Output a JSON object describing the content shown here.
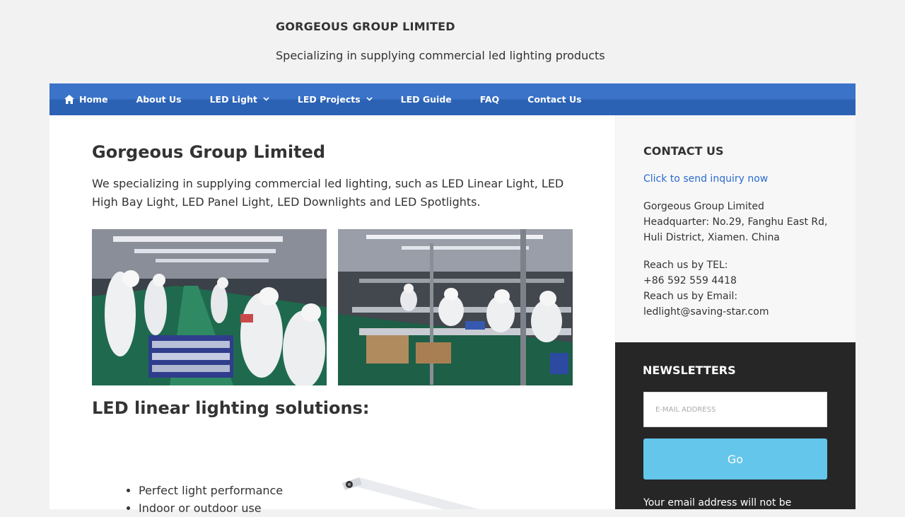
{
  "site": {
    "title": "GORGEOUS GROUP LIMITED",
    "description": "Specializing in supplying commercial led lighting products"
  },
  "nav": {
    "items": [
      {
        "label": "Home",
        "icon": "home-icon",
        "has_dropdown": false
      },
      {
        "label": "About Us",
        "has_dropdown": false
      },
      {
        "label": "LED Light",
        "has_dropdown": true
      },
      {
        "label": "LED Projects",
        "has_dropdown": true
      },
      {
        "label": "LED Guide",
        "has_dropdown": false
      },
      {
        "label": "FAQ",
        "has_dropdown": false
      },
      {
        "label": "Contact Us",
        "has_dropdown": false
      }
    ],
    "color": "#3a73c8"
  },
  "main": {
    "title": "Gorgeous Group Limited",
    "intro": "We specializing in supplying commercial led lighting, such as LED Linear Light, LED High Bay Light, LED Panel Light, LED Downlights and LED Spotlights.",
    "section_title": "LED linear lighting solutions:",
    "features": [
      "Perfect light performance",
      "Indoor or outdoor use"
    ]
  },
  "sidebar": {
    "contact": {
      "title": "CONTACT US",
      "inquiry_link": "Click to send inquiry now",
      "company": "Gorgeous Group Limited",
      "address_line1": "Headquarter: No.29, Fanghu East Rd,",
      "address_line2": "Huli District, Xiamen. China",
      "tel_label": "Reach us by TEL:",
      "tel": "+86 592 559 4418",
      "email_label": "Reach us by Email:",
      "email": "ledlight@saving-star.com"
    },
    "newsletter": {
      "title": "NEWSLETTERS",
      "email_placeholder": "E-MAIL ADDRESS",
      "go_label": "Go",
      "note": "Your email address will not be"
    }
  }
}
